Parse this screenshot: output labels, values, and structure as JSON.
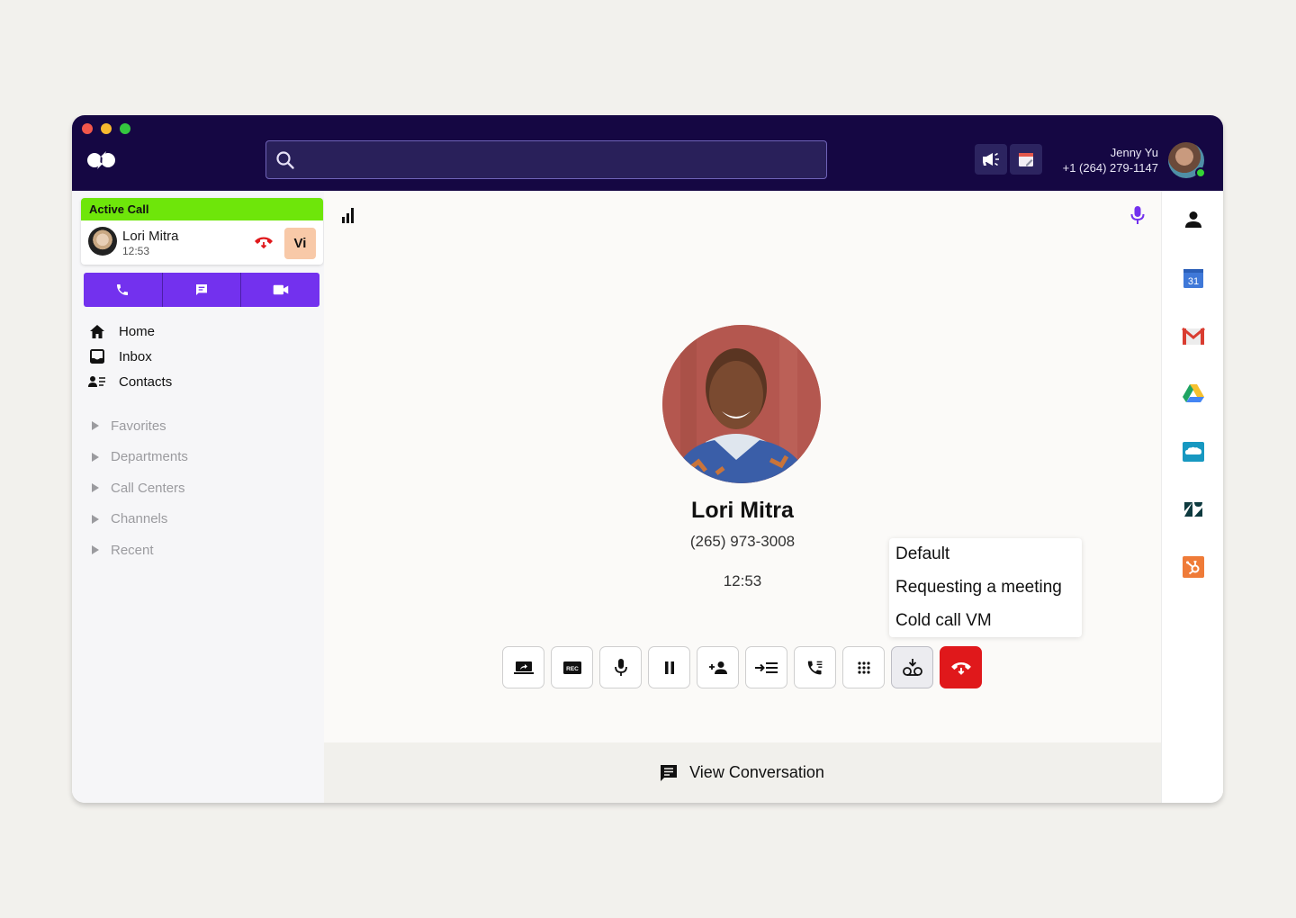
{
  "window": {
    "traffic_lights": [
      "#f2574b",
      "#f7b92f",
      "#34c73f"
    ]
  },
  "topbar": {
    "logo_icon": "dialpad-logo-icon",
    "search": {
      "placeholder": "",
      "value": ""
    },
    "buttons": [
      {
        "name": "announcements",
        "icon": "megaphone-icon"
      },
      {
        "name": "calendar",
        "icon": "calendar-edit-icon"
      }
    ],
    "user": {
      "name": "Jenny Yu",
      "phone": "+1 (264) 279-1147",
      "status": "online",
      "status_color": "#35d435"
    }
  },
  "sidebar": {
    "active_call": {
      "header": "Active Call",
      "name": "Lori Mitra",
      "duration": "12:53",
      "badge": "Vi",
      "header_color": "#6ee60a"
    },
    "quick_actions": [
      {
        "name": "call",
        "icon": "phone-icon"
      },
      {
        "name": "message",
        "icon": "message-icon"
      },
      {
        "name": "video",
        "icon": "video-icon"
      }
    ],
    "nav": [
      {
        "label": "Home",
        "icon": "home-icon"
      },
      {
        "label": "Inbox",
        "icon": "inbox-icon"
      },
      {
        "label": "Contacts",
        "icon": "contacts-icon"
      }
    ],
    "sections": [
      {
        "label": "Favorites"
      },
      {
        "label": "Departments"
      },
      {
        "label": "Call Centers"
      },
      {
        "label": "Channels"
      },
      {
        "label": "Recent"
      }
    ]
  },
  "call": {
    "name": "Lori Mitra",
    "phone": "(265) 973-3008",
    "duration": "12:53",
    "signal_bars": 3,
    "controls": [
      {
        "name": "screen-share",
        "icon": "screen-share-icon"
      },
      {
        "name": "record",
        "icon": "record-icon",
        "label": "REC"
      },
      {
        "name": "mute",
        "icon": "microphone-icon"
      },
      {
        "name": "hold",
        "icon": "pause-icon"
      },
      {
        "name": "add-participant",
        "icon": "add-person-icon"
      },
      {
        "name": "transfer",
        "icon": "transfer-icon"
      },
      {
        "name": "call-queue",
        "icon": "phone-list-icon"
      },
      {
        "name": "keypad",
        "icon": "keypad-icon"
      },
      {
        "name": "voicemail-drop",
        "icon": "voicemail-drop-icon",
        "active": true
      },
      {
        "name": "hang-up",
        "icon": "hang-up-icon"
      }
    ],
    "voicemail_menu": [
      "Default",
      "Requesting a meeting",
      "Cold call VM"
    ],
    "view_conversation": "View Conversation"
  },
  "integrations": [
    {
      "name": "contact-profile",
      "icon": "person-icon"
    },
    {
      "name": "google-calendar",
      "icon": "google-calendar-icon",
      "label": "31"
    },
    {
      "name": "gmail",
      "icon": "gmail-icon"
    },
    {
      "name": "google-drive",
      "icon": "google-drive-icon"
    },
    {
      "name": "salesforce",
      "icon": "salesforce-icon"
    },
    {
      "name": "zendesk",
      "icon": "zendesk-icon"
    },
    {
      "name": "hubspot",
      "icon": "hubspot-icon"
    }
  ],
  "colors": {
    "topbar": "#150743",
    "accent_purple": "#7331ee",
    "hangup_red": "#e0181b",
    "active_green": "#6ee60a"
  }
}
